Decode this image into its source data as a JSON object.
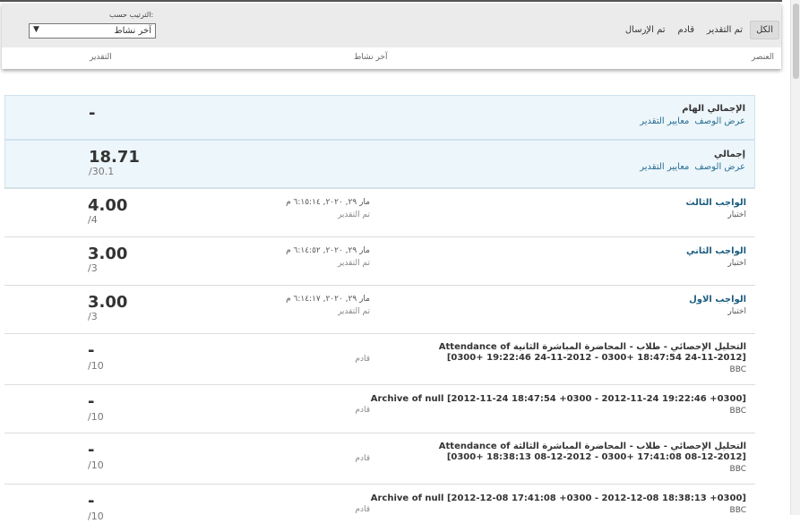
{
  "filters": [
    "الكل",
    "تم التقدير",
    "قادم",
    "تم الإرسال"
  ],
  "sort": {
    "label": "الترتيب حسب:",
    "value": "آخر نشاط"
  },
  "columns": {
    "item": "العنصر",
    "last_activity": "آخر نشاط",
    "grade": "التقدير"
  },
  "rows": [
    {
      "title": "الإجمالي الهام",
      "links": [
        "عرض الوصف",
        "معايير التقدير"
      ],
      "score": "-",
      "out_of": ""
    },
    {
      "title": "إجمالي",
      "links": [
        "عرض الوصف",
        "معايير التقدير"
      ],
      "score": "18.71",
      "out_of": "/30.1"
    },
    {
      "title": "الواجب الثالث",
      "type": "اختبار",
      "date": "مار ٢٩, ٢٠٢٠, ٦:١٥:١٤ م",
      "status": "تم التقدير",
      "score": "4.00",
      "out_of": "/4"
    },
    {
      "title": "الواجب الثاني",
      "type": "اختبار",
      "date": "مار ٢٩, ٢٠٢٠, ٦:١٤:٥٢ م",
      "status": "تم التقدير",
      "score": "3.00",
      "out_of": "/3"
    },
    {
      "title": "الواجب الاول",
      "type": "اختبار",
      "date": "مار ٢٩, ٢٠٢٠, ٦:١٤:١٧ م",
      "status": "تم التقدير",
      "score": "3.00",
      "out_of": "/3"
    },
    {
      "title": "Attendance of التحليل الإحصائي - طلاب - المحاضرة المباشرة الثانية [2012-11-24 18:47:54 +0300 - 2012-11-24 19:22:46 +0300]",
      "type": "BBC",
      "status": "قادم",
      "score": "-",
      "out_of": "/10"
    },
    {
      "title": "Archive of null [2012-11-24 18:47:54 +0300 - 2012-11-24 19:22:46 +0300]",
      "type": "BBC",
      "status": "قادم",
      "score": "-",
      "out_of": "/10"
    },
    {
      "title": "Attendance of التحليل الإحصائي - طلاب - المحاضرة المباشرة الثالثة [2012-12-08 17:41:08 +0300 - 2012-12-08 18:38:13 +0300]",
      "type": "BBC",
      "status": "قادم",
      "score": "-",
      "out_of": "/10"
    },
    {
      "title": "Archive of null [2012-12-08 17:41:08 +0300 - 2012-12-08 18:38:13 +0300]",
      "type": "BBC",
      "status": "قادم",
      "score": "-",
      "out_of": "/10"
    }
  ]
}
